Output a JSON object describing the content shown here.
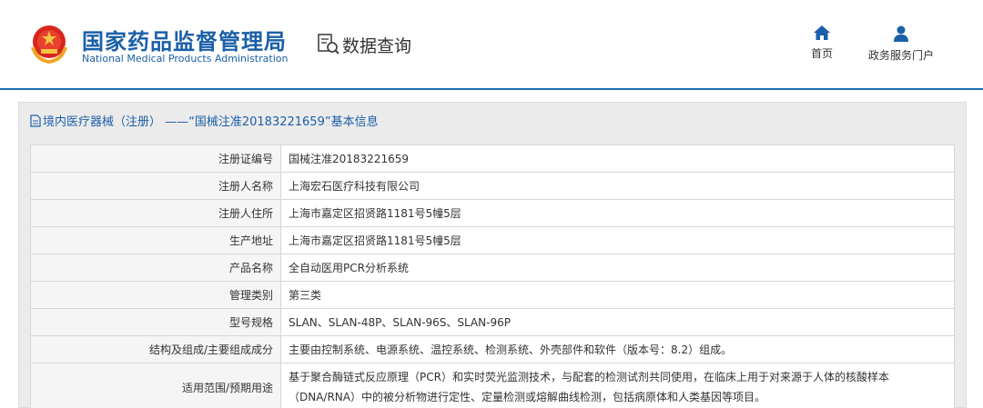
{
  "header": {
    "logo_cn": "国家药品监督管理局",
    "logo_en": "National Medical Products Administration",
    "search_title": "数据查询",
    "nav": {
      "home": "首页",
      "portal": "政务服务门户"
    },
    "accent_color": "#1b5fa8"
  },
  "panel": {
    "title": "境内医疗器械（注册） ——“国械注准20183221659”基本信息",
    "rows": [
      {
        "label": "注册证编号",
        "value": "国械注准20183221659"
      },
      {
        "label": "注册人名称",
        "value": "上海宏石医疗科技有限公司"
      },
      {
        "label": "注册人住所",
        "value": "上海市嘉定区招贤路1181号5幢5层"
      },
      {
        "label": "生产地址",
        "value": "上海市嘉定区招贤路1181号5幢5层"
      },
      {
        "label": "产品名称",
        "value": "全自动医用PCR分析系统"
      },
      {
        "label": "管理类别",
        "value": "第三类"
      },
      {
        "label": "型号规格",
        "value": "SLAN、SLAN-48P、SLAN-96S、SLAN-96P"
      },
      {
        "label": "结构及组成/主要组成成分",
        "value": "主要由控制系统、电源系统、温控系统、检测系统、外壳部件和软件（版本号：8.2）组成。"
      },
      {
        "label": "适用范围/预期用途",
        "value": "基于聚合酶链式反应原理（PCR）和实时荧光监测技术，与配套的检测试剂共同使用，在临床上用于对来源于人体的核酸样本（DNA/RNA）中的被分析物进行定性、定量检测或熔解曲线检测，包括病原体和人类基因等项目。"
      }
    ]
  }
}
